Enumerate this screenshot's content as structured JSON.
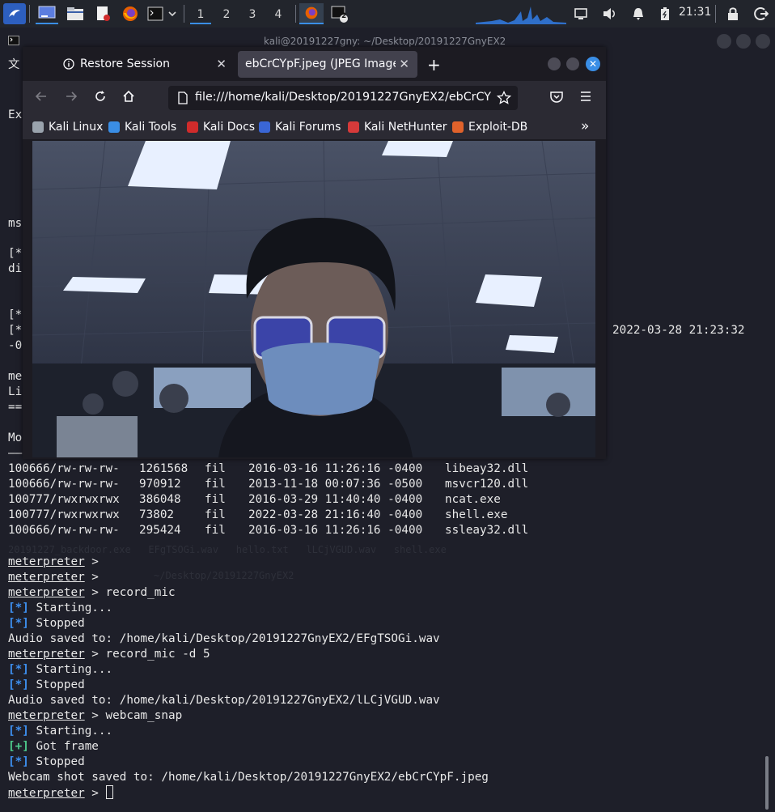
{
  "panel": {
    "workspaces": [
      "1",
      "2",
      "3",
      "4"
    ],
    "terminal_badge": "2",
    "clock": "21:31"
  },
  "terminal": {
    "window_title": "kali@20191227gny: ~/Desktop/20191227GnyEX2",
    "left_fragments": [
      "文",
      "Ex",
      "ms",
      "[*",
      "di",
      "[*",
      "[*",
      "-0",
      "me",
      "Li",
      "==",
      "Mo",
      "——"
    ],
    "timestamp_fragment": "2022-03-28 21:23:32",
    "listing": [
      {
        "mode": "100666/rw-rw-rw-",
        "size": "1261568",
        "type": "fil",
        "modified": "2016-03-16 11:26:16 -0400",
        "name": "libeay32.dll"
      },
      {
        "mode": "100666/rw-rw-rw-",
        "size": "970912",
        "type": "fil",
        "modified": "2013-11-18 00:07:36 -0500",
        "name": "msvcr120.dll"
      },
      {
        "mode": "100777/rwxrwxrwx",
        "size": "386048",
        "type": "fil",
        "modified": "2016-03-29 11:40:40 -0400",
        "name": "ncat.exe"
      },
      {
        "mode": "100777/rwxrwxrwx",
        "size": "73802",
        "type": "fil",
        "modified": "2022-03-28 21:16:40 -0400",
        "name": "shell.exe"
      },
      {
        "mode": "100666/rw-rw-rw-",
        "size": "295424",
        "type": "fil",
        "modified": "2016-03-16 11:26:16 -0400",
        "name": "ssleay32.dll"
      }
    ],
    "ghost_lines": [
      "20191227_backdoor.exe   EFgTSOGi.wav   hello.txt   lLCjVGUD.wav   shell.exe",
      "~/Desktop/20191227GnyEX2"
    ],
    "prompt": "meterpreter",
    "cmd_record_mic": "record_mic",
    "cmd_record_mic_d5": "record_mic -d 5",
    "cmd_webcam_snap": "webcam_snap",
    "tag_info": "[*]",
    "tag_ok": "[+]",
    "starting": "Starting...",
    "stopped": "Stopped",
    "got_frame": "Got frame",
    "audio1": "Audio saved to: /home/kali/Desktop/20191227GnyEX2/EFgTSOGi.wav",
    "audio2": "Audio saved to: /home/kali/Desktop/20191227GnyEX2/lLCjVGUD.wav",
    "webcam": "Webcam shot saved to: /home/kali/Desktop/20191227GnyEX2/ebCrCYpF.jpeg"
  },
  "firefox": {
    "tabs": [
      {
        "label": "Restore Session"
      },
      {
        "label": "ebCrCYpF.jpeg (JPEG Image,"
      }
    ],
    "url": "file:///home/kali/Desktop/20191227GnyEX2/ebCrCYpF.jpeg",
    "bookmarks": [
      {
        "label": "Kali Linux",
        "color": "#9aa3ad"
      },
      {
        "label": "Kali Tools",
        "color": "#3a8ee6"
      },
      {
        "label": "Kali Docs",
        "color": "#d02b2b"
      },
      {
        "label": "Kali Forums",
        "color": "#3a66d6"
      },
      {
        "label": "Kali NetHunter",
        "color": "#d63a3a"
      },
      {
        "label": "Exploit-DB",
        "color": "#e0622b"
      }
    ]
  },
  "colors": {
    "accent": "#3a8ee6",
    "prompt_info": "#3d8fef",
    "prompt_ok": "#4ec98b"
  }
}
